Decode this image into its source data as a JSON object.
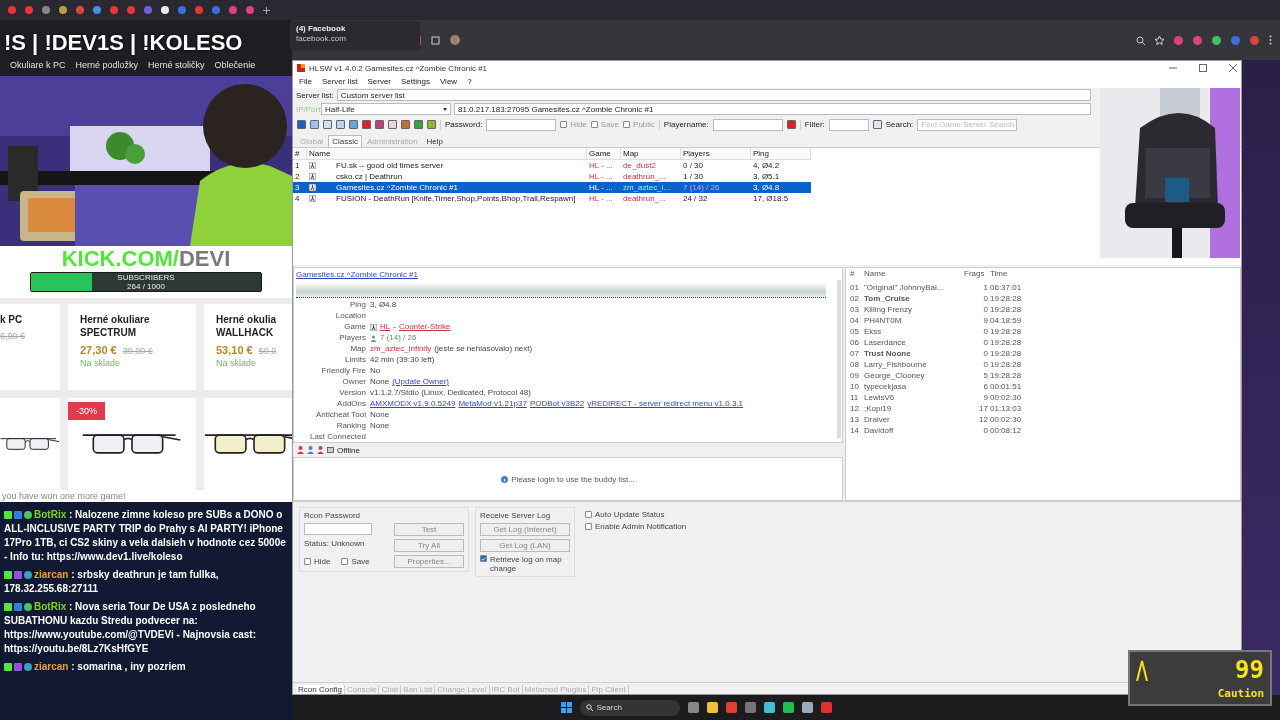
{
  "tooltip": {
    "title": "(4) Facebook",
    "url": "facebook.com"
  },
  "stream": {
    "title": "!S | !DEV1S | !KOLESO",
    "nav": [
      "Okuliare k PC",
      "Herné podložky",
      "Herné stoličky",
      "Oblečenie"
    ],
    "kick": [
      "KICK.COM/",
      "DEVI"
    ],
    "subscribers": {
      "label": "SUBSCRIBERS",
      "count": "264 / 1000",
      "level": 0.264
    },
    "products": [
      {
        "name": "k PC",
        "old_price": "6,00 €"
      },
      {
        "name": "Herné okuliare",
        "subname": "SPECTRUM",
        "price": "27,30 €",
        "old_price": "39,00 €",
        "stock": "Na sklade"
      },
      {
        "name": "Herné okulia",
        "subname": "WALLHACK",
        "price": "53,10 €",
        "old_price": "59,0",
        "stock": "Na sklade"
      }
    ],
    "images": [
      {
        "kind": "picture"
      },
      {
        "kind": "picture",
        "badge": "-30%"
      },
      {
        "kind": "picture"
      }
    ],
    "notice": "you have won one more game!",
    "chat": [
      {
        "user": "BotRix",
        "color": "#7ed321",
        "text": ": Nalozene zimne koleso pre SUBs a DONO o ALL-INCLUSIVE PARTY TRIP do Prahy s AI PARTY! iPhone 17Pro 1TB, ci CS2 skiny a vela dalsieh v hodnote cez 5000e - Info tu: https://www.dev1.live/koleso"
      },
      {
        "user": "ziarcan",
        "color": "#e8a030",
        "text": ": srbsky deathrun je tam fullka, 178.32.255.68:27111"
      },
      {
        "user": "BotRix",
        "color": "#7ed321",
        "text": ": Nova seria Tour De USA z posledneho SUBATHONU kazdu Stredu podvecer na: https://www.youtube.com/@TVDEVi - Najnovsia cast: https://youtu.be/8Lz7KsHfGYE"
      },
      {
        "user": "ziarcan",
        "color": "#e8a030",
        "text": ": somarina , iny pozriem"
      }
    ]
  },
  "hlsw": {
    "title": "HLSW v1.4.0.2   Gamesites.cz ^Zombie Chronic #1",
    "menu": [
      "File",
      "Server list",
      "Server",
      "Settings",
      "View",
      "?"
    ],
    "server_list": {
      "label": "Server list:",
      "value": "Custom server list"
    },
    "ip_port": {
      "label": "IP/Port",
      "disabled": true,
      "game": "Half-Life",
      "value": "81.0.217.183:27095 Gamesites.cz ^Zombie Chronic #1"
    },
    "toolbar": {
      "password_label": "Password:",
      "options": [
        {
          "label": "Hide",
          "checked": false
        },
        {
          "label": "Save",
          "checked": false
        },
        {
          "label": "Public",
          "checked": false
        }
      ],
      "playername_label": "Playername:",
      "filter_label": "Filter:",
      "search_label": "Search:",
      "search_placeholder": "Find Game Server Search"
    },
    "mode_tabs": [
      {
        "label": "Global",
        "selected": false,
        "disabled": true
      },
      {
        "label": "Classic",
        "selected": true,
        "disabled": false
      },
      {
        "label": "Administration",
        "selected": false,
        "disabled": true
      },
      {
        "label": "Help",
        "selected": false,
        "disabled": false
      }
    ],
    "servers": {
      "columns": [
        "#",
        "Name",
        "Game",
        "Map",
        "Players",
        "Ping"
      ],
      "rows": [
        {
          "num": "1",
          "name": "FU.sk -- good old times server",
          "game": "HL - ...",
          "map": "de_dust2",
          "players": "0 / 30",
          "ping": "4, Ø4.2",
          "selected": false
        },
        {
          "num": "2",
          "name": "csko.cz | Deathrun",
          "game": "HL - ...",
          "map": "deathrun_...",
          "players": "1 / 30",
          "ping": "3, Ø5.1",
          "selected": false
        },
        {
          "num": "3",
          "name": "Gamesites.cz ^Zombie Chronic #1",
          "game": "HL - ...",
          "map": "zm_aztec_i...",
          "players": "7 (14) / 26",
          "ping": "3, Ø4.8",
          "selected": true
        },
        {
          "num": "4",
          "name": "FUSION - DeathRun [Knife,Timer,Shop,Points,Bhop,Trail,Respawn]",
          "game": "HL - ...",
          "map": "deathrun_...",
          "players": "24 / 32",
          "ping": "17, Ø18.5",
          "selected": false
        }
      ]
    },
    "details": {
      "link": "Gamesites.cz ^Zombie Chronic #1",
      "rows": [
        {
          "label": "Ping",
          "kind": "plain",
          "parts": [
            {
              "text": "3, Ø4.8",
              "kind": "plain"
            }
          ]
        },
        {
          "label": "Location",
          "kind": "plain",
          "parts": []
        },
        {
          "label": "Game",
          "kind": "game",
          "parts": [
            {
              "text": "HL",
              "kind": "red-link"
            },
            {
              "text": "-",
              "kind": "plain"
            },
            {
              "text": "Counter-Strike",
              "kind": "red-link"
            }
          ]
        },
        {
          "label": "Players",
          "kind": "players",
          "parts": [
            {
              "text": "7 (14) / 26",
              "kind": "green"
            }
          ]
        },
        {
          "label": "Map",
          "kind": "plain",
          "parts": [
            {
              "text": "zm_aztec_infinity",
              "kind": "red"
            },
            {
              "text": "(jeste se nehlasovalo) next)",
              "kind": "plain"
            }
          ]
        },
        {
          "label": "Limits",
          "kind": "plain",
          "parts": [
            {
              "text": "42 min (39:30 left)",
              "kind": "plain"
            }
          ]
        },
        {
          "label": "Friendly Fire",
          "kind": "plain",
          "parts": [
            {
              "text": "No",
              "kind": "plain"
            }
          ]
        },
        {
          "label": "Owner",
          "kind": "plain",
          "parts": [
            {
              "text": "None",
              "kind": "plain"
            },
            {
              "text": "(Update Owner)",
              "kind": "link"
            }
          ]
        },
        {
          "label": "Version",
          "kind": "plain",
          "parts": [
            {
              "text": "v1.1.2.7/Stdio (Linux, Dedicated, Protocol 48)",
              "kind": "plain"
            }
          ]
        },
        {
          "label": "AddOns",
          "kind": "plain",
          "parts": [
            {
              "text": "AMXMODX v1.9.0.5249",
              "kind": "link"
            },
            {
              "text": "MetaMod v1.21p37",
              "kind": "link"
            },
            {
              "text": "PODBot v3B22",
              "kind": "link"
            },
            {
              "text": "yREDIRECT - server redirect menu v1.0.3.1",
              "kind": "link"
            }
          ]
        },
        {
          "label": "Anticheat Tool",
          "kind": "plain",
          "parts": [
            {
              "text": "None",
              "kind": "plain"
            }
          ]
        },
        {
          "label": "Ranking",
          "kind": "plain",
          "parts": [
            {
              "text": "None",
              "kind": "plain"
            }
          ]
        },
        {
          "label": "Last Connected",
          "kind": "plain",
          "parts": []
        }
      ]
    },
    "buddy": {
      "status": "Offline",
      "message": "Please login to use the buddy list..."
    },
    "players": {
      "columns": [
        "#",
        "Name",
        "Frags",
        "Time"
      ],
      "rows": [
        {
          "num": "01",
          "name": "\"Original\" JohnnyBal...",
          "frags": "1",
          "time": "06:37:01",
          "bold": false
        },
        {
          "num": "02",
          "name": "Tom_Cruise",
          "frags": "0",
          "time": "19:28:28",
          "bold": true
        },
        {
          "num": "03",
          "name": "Killing Frenzy",
          "frags": "0",
          "time": "19:28:28",
          "bold": false
        },
        {
          "num": "04",
          "name": "PH4NT0M",
          "frags": "9",
          "time": "04:18:59",
          "bold": false
        },
        {
          "num": "05",
          "name": "Ekss",
          "frags": "0",
          "time": "19:28:28",
          "bold": false
        },
        {
          "num": "06",
          "name": "Laserdance",
          "frags": "0",
          "time": "19:28:28",
          "bold": false
        },
        {
          "num": "07",
          "name": "Trust Noone",
          "frags": "0",
          "time": "19:28:28",
          "bold": true
        },
        {
          "num": "08",
          "name": "Larry_Fishbourne",
          "frags": "0",
          "time": "19:28:28",
          "bold": false
        },
        {
          "num": "09",
          "name": "George_Clooney",
          "frags": "5",
          "time": "19:28:28",
          "bold": false
        },
        {
          "num": "10",
          "name": "typecekjasa",
          "frags": "6",
          "time": "00:01:51",
          "bold": false
        },
        {
          "num": "11",
          "name": "LewisV6",
          "frags": "9",
          "time": "00:02:30",
          "bold": false
        },
        {
          "num": "12",
          "name": ";Kopi19",
          "frags": "17",
          "time": "01:13:03",
          "bold": false
        },
        {
          "num": "13",
          "name": "Draiver",
          "frags": "12",
          "time": "00:02:30",
          "bold": false
        },
        {
          "num": "14",
          "name": "Davidoff",
          "frags": "0",
          "time": "00:08:12",
          "bold": false
        }
      ]
    },
    "rcon": {
      "title": "Rcon Password",
      "status": "Status:  Unknown",
      "buttons": [
        "Test",
        "Try All",
        "Properties..."
      ],
      "checks": [
        {
          "label": "Hide",
          "checked": false
        },
        {
          "label": "Save",
          "checked": false
        }
      ]
    },
    "log": {
      "title": "Receive Server Log",
      "buttons": [
        "Get Log (Internet)",
        "Get Log (LAN)"
      ],
      "check": {
        "label": "Retrieve log on map change",
        "checked": true
      }
    },
    "options": [
      {
        "label": "Auto Update Status",
        "checked": false
      },
      {
        "label": "Enable Admin Notification",
        "checked": false
      }
    ],
    "bottom_tabs": [
      {
        "label": "Rcon Config",
        "selected": true
      },
      {
        "label": "Console",
        "selected": false
      },
      {
        "label": "Chat",
        "selected": false
      },
      {
        "label": "Ban List",
        "selected": false
      },
      {
        "label": "Change Level",
        "selected": false
      },
      {
        "label": "IRC Bot",
        "selected": false
      },
      {
        "label": "Metamod Plugins",
        "selected": false
      },
      {
        "label": "Ftp Client",
        "selected": false
      }
    ]
  },
  "taskbar": {
    "search": "Search"
  },
  "hud": {
    "value": "99",
    "label": "Caution"
  }
}
